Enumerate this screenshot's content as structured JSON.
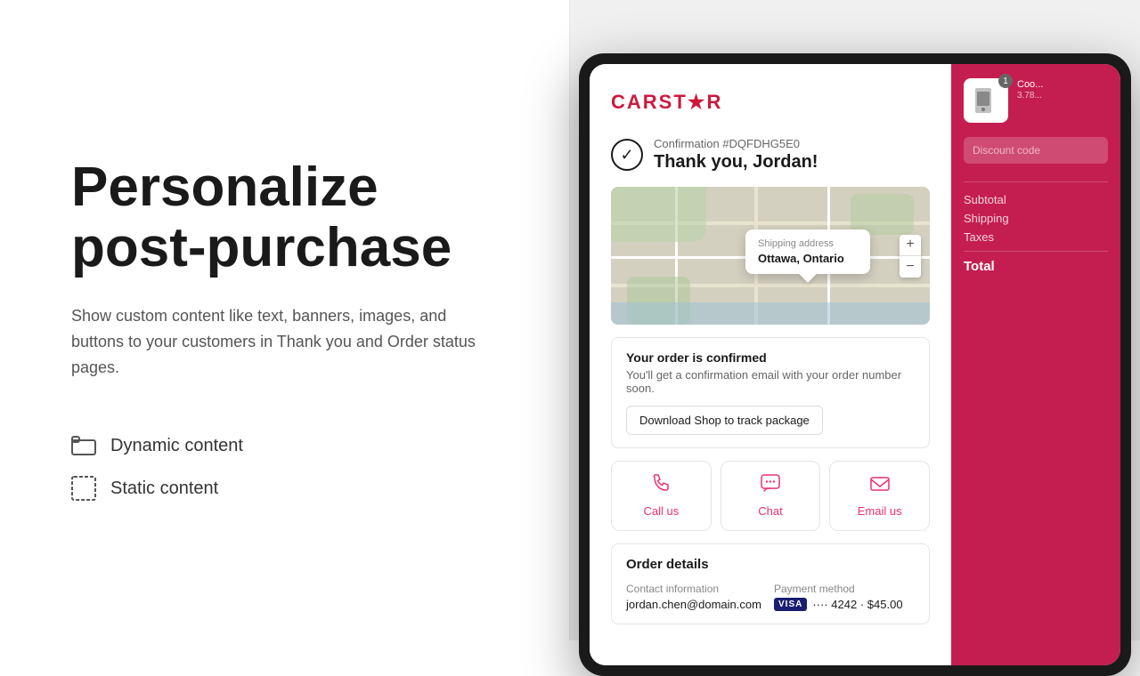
{
  "left": {
    "heading_line1": "Personalize",
    "heading_line2": "post-purchase",
    "description": "Show custom content like text, banners, images, and buttons to your customers in Thank you and Order status pages.",
    "features": [
      {
        "id": "dynamic",
        "label": "Dynamic content",
        "icon": "dynamic-content-icon"
      },
      {
        "id": "static",
        "label": "Static content",
        "icon": "static-content-icon"
      }
    ]
  },
  "tablet": {
    "logo": "CARSTAR",
    "confirmation": {
      "number": "Confirmation #DQFDHG5E0",
      "thanks": "Thank you, Jordan!"
    },
    "map": {
      "shipping_label": "Shipping address",
      "city": "Ottawa, Ontario",
      "zoom_in": "+",
      "zoom_out": "−"
    },
    "order_confirmed": {
      "title": "Your order is confirmed",
      "description": "You'll get a confirmation email with your order number soon.",
      "download_btn": "Download Shop to track package"
    },
    "contact_buttons": [
      {
        "id": "call",
        "label": "Call us",
        "icon": "phone-icon"
      },
      {
        "id": "chat",
        "label": "Chat",
        "icon": "chat-icon"
      },
      {
        "id": "email",
        "label": "Email us",
        "icon": "email-icon"
      }
    ],
    "order_details": {
      "title": "Order details",
      "contact_label": "Contact information",
      "contact_value": "jordan.chen@domain.com",
      "payment_label": "Payment method",
      "payment_visa": "VISA",
      "payment_dots": "····",
      "payment_last4": "4242",
      "payment_amount": "$45.00"
    }
  },
  "cart_sidebar": {
    "item": {
      "badge": "1",
      "name": "Coo...",
      "detail": "3.78...",
      "img_label": "product-image"
    },
    "discount_placeholder": "Discount code",
    "subtotal_label": "Subtotal",
    "subtotal_value": "",
    "shipping_label": "Shipping",
    "shipping_value": "",
    "taxes_label": "Taxes",
    "taxes_value": "",
    "total_label": "Total",
    "total_value": ""
  }
}
